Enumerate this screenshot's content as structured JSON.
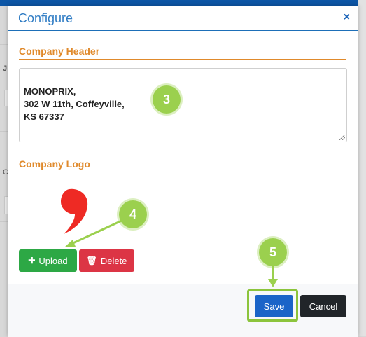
{
  "background": {
    "peek_char_1": "J",
    "peek_char_2": "C"
  },
  "modal": {
    "title": "Configure",
    "close_label": "×"
  },
  "company_header": {
    "section_title": "Company Header",
    "value": "MONOPRIX,\n302 W 11th, Coffeyville,\nKS 67337"
  },
  "company_logo": {
    "section_title": "Company Logo",
    "logo_icon": "red-comma-logo",
    "upload_label": "Upload",
    "upload_icon": "plus-icon",
    "delete_label": "Delete",
    "delete_icon": "trash-icon"
  },
  "footer": {
    "save_label": "Save",
    "cancel_label": "Cancel"
  },
  "callouts": [
    {
      "number": "3"
    },
    {
      "number": "4"
    },
    {
      "number": "5"
    }
  ],
  "colors": {
    "accent_blue": "#1b64c8",
    "section_orange": "#e08a2c",
    "upload_green": "#2da845",
    "delete_red": "#dc3545",
    "callout_green": "#9bd04e",
    "logo_red": "#ee2a24"
  }
}
